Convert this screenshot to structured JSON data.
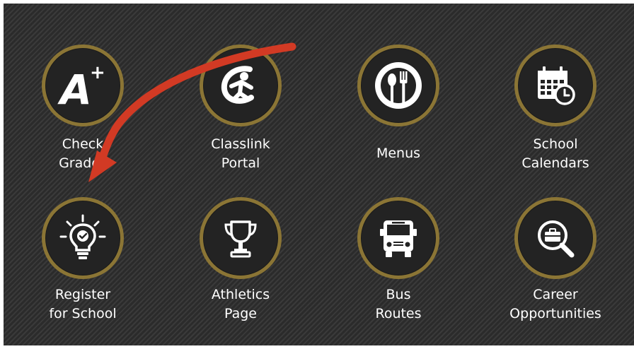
{
  "tiles": [
    {
      "line1": "Check",
      "line2": "Grades",
      "icon": "a-plus-icon"
    },
    {
      "line1": "Classlink",
      "line2": "Portal",
      "icon": "classlink-logo-icon"
    },
    {
      "line1": "Menus",
      "line2": "",
      "icon": "plate-fork-spoon-icon"
    },
    {
      "line1": "School",
      "line2": "Calendars",
      "icon": "calendar-clock-icon"
    },
    {
      "line1": "Register",
      "line2": "for School",
      "icon": "lightbulb-check-icon"
    },
    {
      "line1": "Athletics",
      "line2": "Page",
      "icon": "trophy-icon"
    },
    {
      "line1": "Bus",
      "line2": "Routes",
      "icon": "bus-icon"
    },
    {
      "line1": "Career",
      "line2": "Opportunities",
      "icon": "briefcase-search-icon"
    }
  ],
  "icon_text": {
    "a_plus_letter": "A",
    "a_plus_sign": "+"
  },
  "colors": {
    "panel_bg": "#2f2f2f",
    "circle_ring": "#8b7535",
    "circle_bg": "#232323",
    "label_text": "#ffffff",
    "arrow": "#d23a24"
  }
}
